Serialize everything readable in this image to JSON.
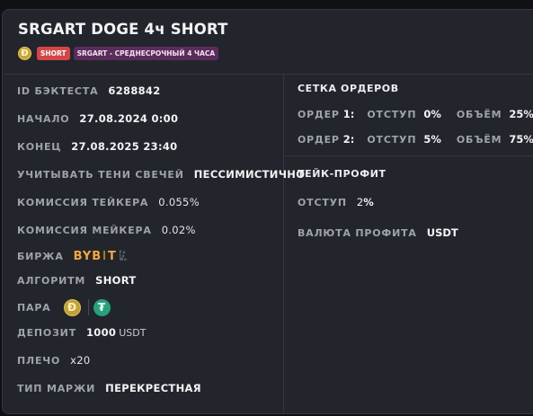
{
  "header": {
    "title": "SRGART DOGE 4ч SHORT",
    "coin_glyph": "Ð",
    "tag_short": "SHORT",
    "tag_strategy": "SRGART - СРЕДНЕСРОЧНЫЙ 4 ЧАСА"
  },
  "details": {
    "id_label": "ID БЭКТЕСТА",
    "id_value": "6288842",
    "start_label": "НАЧАЛО",
    "start_value": "27.08.2024 0:00",
    "end_label": "КОНЕЦ",
    "end_value": "27.08.2025 23:40",
    "shadows_label": "УЧИТЫВАТЬ ТЕНИ СВЕЧЕЙ",
    "shadows_value": "ПЕССИМИСТИЧНО",
    "taker_label": "КОМИССИЯ ТЕЙКЕРА",
    "taker_value": "0.055",
    "taker_unit": "%",
    "maker_label": "КОМИССИЯ МЕЙКЕРА",
    "maker_value": "0.02",
    "maker_unit": "%",
    "exchange_label": "БИРЖА",
    "exchange_logo": {
      "left": "BYB",
      "mid": "I",
      "right": "T",
      "sub1": "Fo",
      "sub2": "to",
      "sub3": "Wo"
    },
    "algo_label": "АЛГОРИТМ",
    "algo_value": "SHORT",
    "pair_label": "ПАРА",
    "pair_base_glyph": "Ð",
    "pair_quote_glyph": "₮",
    "deposit_label": "ДЕПОЗИТ",
    "deposit_value": "1000",
    "deposit_unit": "USDT",
    "leverage_label": "ПЛЕЧО",
    "leverage_prefix": "x",
    "leverage_value": "20",
    "margin_label": "ТИП МАРЖИ",
    "margin_value": "ПЕРЕКРЕСТНАЯ"
  },
  "order_grid": {
    "title": "СЕТКА ОРДЕРОВ",
    "orders": [
      {
        "label": "ОРДЕР",
        "index": "1:",
        "offset_label": "ОТСТУП",
        "offset_value": "0",
        "offset_unit": "%",
        "volume_label": "ОБЪЁМ",
        "volume_value": "25",
        "volume_unit": "%"
      },
      {
        "label": "ОРДЕР",
        "index": "2:",
        "offset_label": "ОТСТУП",
        "offset_value": "5",
        "offset_unit": "%",
        "volume_label": "ОБЪЁМ",
        "volume_value": "75",
        "volume_unit": "%"
      }
    ]
  },
  "take_profit": {
    "title": "ТЕЙК-ПРОФИТ",
    "offset_label": "ОТСТУП",
    "offset_value": "2",
    "offset_unit": "%",
    "currency_label": "ВАЛЮТА ПРОФИТА",
    "currency_value": "USDT"
  },
  "colors": {
    "background": "#101114",
    "card": "#23252c",
    "short_tag": "#d64545",
    "strategy_tag": "#5b2c5b",
    "doge": "#c3a235",
    "usdt": "#26a17b",
    "bybit": "#f2a83b"
  },
  "icons": {
    "base_coin": "doge-coin-icon",
    "quote_coin": "usdt-coin-icon",
    "exchange": "bybit-logo"
  }
}
